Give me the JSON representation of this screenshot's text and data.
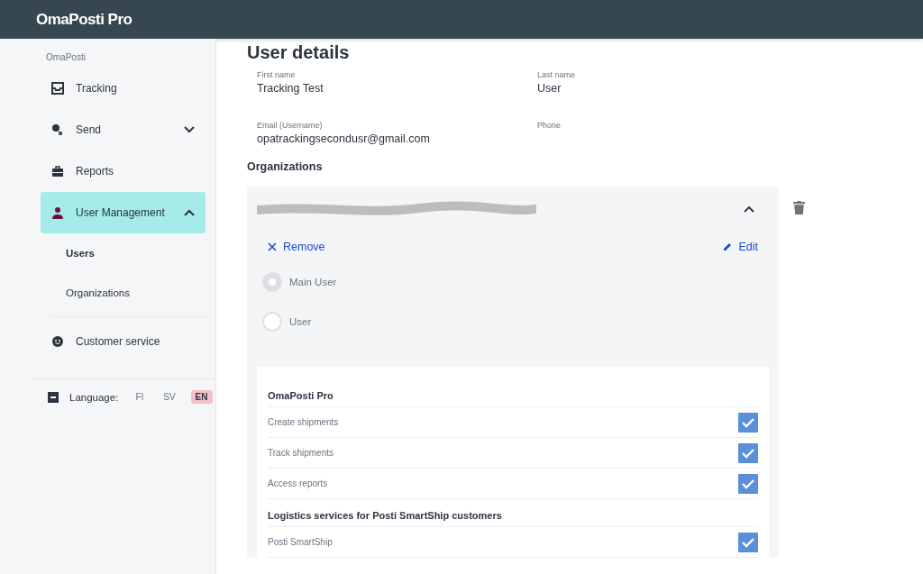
{
  "header": {
    "title": "OmaPosti Pro"
  },
  "sidebar": {
    "section_label": "OmaPosti",
    "items": [
      {
        "kind": "tracking",
        "label": "Tracking",
        "selected": false
      },
      {
        "kind": "send",
        "label": "Send",
        "selected": false,
        "expanded": false
      },
      {
        "kind": "reports",
        "label": "Reports",
        "selected": false
      },
      {
        "kind": "user",
        "label": "User Management",
        "selected": true,
        "expanded": true,
        "children": [
          {
            "label": "Users",
            "selected": true
          },
          {
            "label": "Organizations",
            "selected": false
          }
        ]
      },
      {
        "kind": "service",
        "label": "Customer service",
        "selected": false
      }
    ],
    "language": {
      "label": "Language:",
      "options": [
        {
          "label": "FI",
          "selected": false
        },
        {
          "label": "SV",
          "selected": false
        },
        {
          "label": "EN",
          "selected": true
        }
      ]
    }
  },
  "page": {
    "title": "User details",
    "fields": [
      {
        "label": "First name",
        "value": "Tracking Test"
      },
      {
        "label": "Last name",
        "value": "User"
      },
      {
        "label": "Email (Username)",
        "value": "opatrackingsecondusr@gmail.com"
      },
      {
        "label": "Phone"
      }
    ],
    "organizations_title": "Organizations",
    "organization": {
      "expanded": true,
      "remove_label": "Remove",
      "edit_label": "Edit",
      "roles": [
        {
          "label": "Main User",
          "selected": true
        },
        {
          "label": "User",
          "selected": false
        }
      ],
      "groups": [
        {
          "title": "OmaPosti Pro",
          "permissions": [
            {
              "label": "Create shipments",
              "checked": true
            },
            {
              "label": "Track shipments",
              "checked": true
            },
            {
              "label": "Access reports",
              "checked": true
            }
          ]
        },
        {
          "title": "Logistics services for Posti SmartShip customers",
          "permissions": [
            {
              "label": "Posti SmartShip",
              "checked": true
            }
          ]
        }
      ]
    }
  }
}
